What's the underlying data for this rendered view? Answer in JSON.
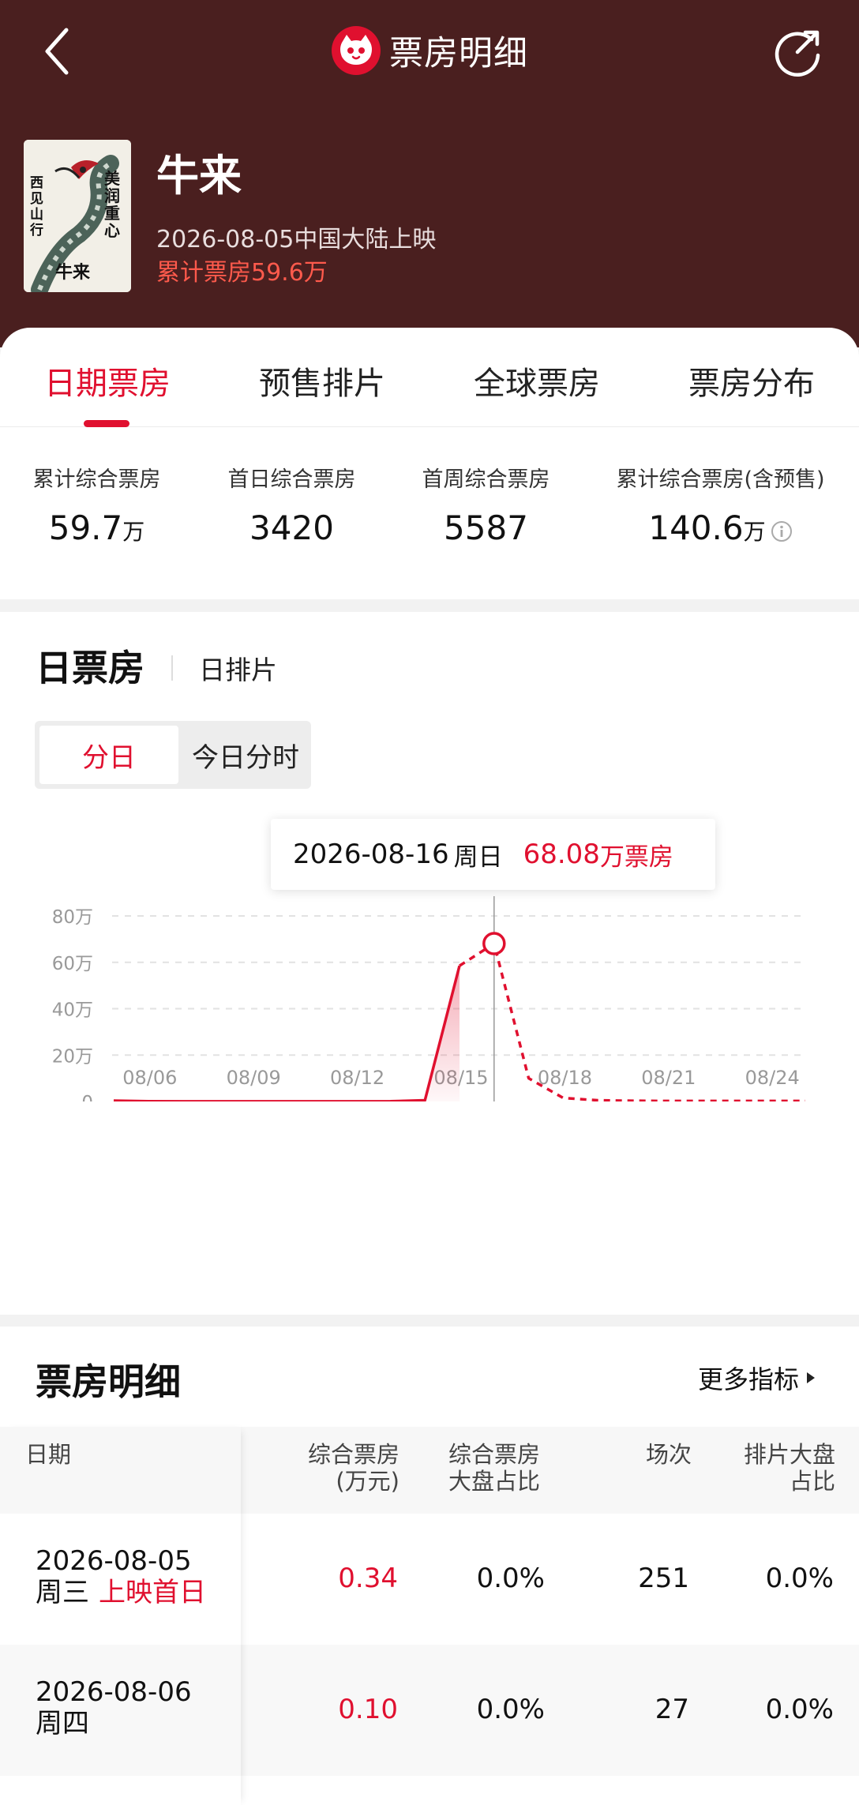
{
  "nav": {
    "title": "票房明细"
  },
  "movie": {
    "title": "牛来",
    "release_line": "2026-08-05中国大陆上映",
    "cumulative_line": "累计票房59.6万",
    "poster_text": [
      "美",
      "润",
      "重",
      "心",
      "西",
      "见",
      "山",
      "行",
      "牛来"
    ]
  },
  "tabs": [
    {
      "label": "日期票房",
      "active": true
    },
    {
      "label": "预售排片",
      "active": false
    },
    {
      "label": "全球票房",
      "active": false
    },
    {
      "label": "票房分布",
      "active": false
    }
  ],
  "stats": [
    {
      "label": "累计综合票房",
      "value": "59.7",
      "unit": "万"
    },
    {
      "label": "首日综合票房",
      "value": "3420",
      "unit": ""
    },
    {
      "label": "首周综合票房",
      "value": "5587",
      "unit": ""
    },
    {
      "label": "累计综合票房(含预售)",
      "value": "140.6",
      "unit": "万"
    }
  ],
  "chart_section": {
    "title": "日票房",
    "sub_tab": "日排片",
    "segments": [
      {
        "label": "分日",
        "active": true
      },
      {
        "label": "今日分时",
        "active": false
      }
    ],
    "tooltip": {
      "date": "2026-08-16",
      "weekday": "周日",
      "value": "68.08",
      "unit": "万票房"
    }
  },
  "chart_data": {
    "type": "line",
    "x": [
      "08/05",
      "08/06",
      "08/07",
      "08/08",
      "08/09",
      "08/10",
      "08/11",
      "08/12",
      "08/13",
      "08/14",
      "08/15",
      "08/16",
      "08/17",
      "08/18",
      "08/19",
      "08/20",
      "08/21",
      "08/22",
      "08/23",
      "08/24",
      "08/25"
    ],
    "x_tick_labels": [
      "08/06",
      "08/09",
      "08/12",
      "08/15",
      "08/18",
      "08/21",
      "08/24"
    ],
    "y_tick_labels": [
      "0",
      "20万",
      "40万",
      "60万",
      "80万"
    ],
    "series": [
      {
        "values": [
          0.34,
          0.1,
          0.05,
          0.05,
          0.05,
          0.05,
          0.05,
          0.05,
          0.1,
          0.5,
          58.5,
          68.08,
          10.0,
          1.5,
          0.5,
          0.3,
          0.2,
          0.2,
          0.2,
          0.2,
          0.2
        ],
        "solid_until_index": 10,
        "color": "#e0102f"
      }
    ],
    "ylim": [
      0,
      80
    ],
    "y_ticks": [
      0,
      20,
      40,
      60,
      80
    ],
    "highlight_index": 11,
    "grid": true,
    "grid_style": "dashed"
  },
  "table": {
    "title": "票房明细",
    "more_label": "更多指标",
    "headers": [
      {
        "line1": "日期",
        "line2": ""
      },
      {
        "line1": "综合票房",
        "line2": "(万元)"
      },
      {
        "line1": "综合票房",
        "line2": "大盘占比"
      },
      {
        "line1": "场次",
        "line2": ""
      },
      {
        "line1": "排片大盘",
        "line2": "占比"
      }
    ],
    "rows": [
      {
        "date": "2026-08-05",
        "weekday": "周三",
        "tag": "上映首日",
        "box": "0.34",
        "share": "0.0%",
        "shows": "251",
        "slot": "0.0%"
      },
      {
        "date": "2026-08-06",
        "weekday": "周四",
        "tag": "",
        "box": "0.10",
        "share": "0.0%",
        "shows": "27",
        "slot": "0.0%"
      }
    ]
  },
  "colors": {
    "header_bg": "#4a1f1f",
    "accent": "#e0102f",
    "cum_text": "#ff5a4c"
  }
}
